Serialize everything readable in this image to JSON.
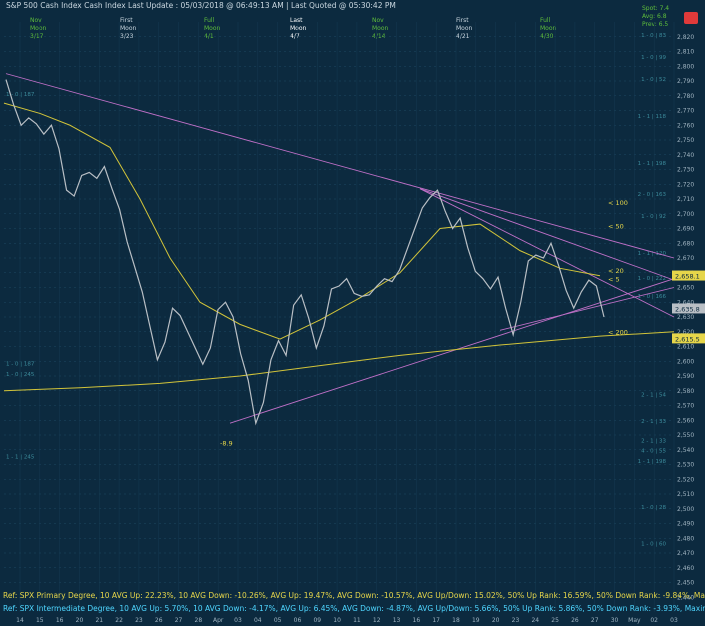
{
  "header": {
    "title": "S&P 500 Cash Index   Cash Index   Last Update : 05/03/2018 @ 06:49:13 AM | Last Quoted @ 05:30:42 PM",
    "phases": [
      {
        "top": "Nov",
        "mid": "Moon",
        "date": "3/17",
        "color": "#5fbf3b"
      },
      {
        "top": "First",
        "mid": "Moon",
        "date": "3/23",
        "color": "#c9d6df"
      },
      {
        "top": "Full",
        "mid": "Moon",
        "date": "4/1",
        "color": "#5fbf3b"
      },
      {
        "top": "Last",
        "mid": "Moon",
        "date": "4/7",
        "color": "#ffffff"
      },
      {
        "top": "Nov",
        "mid": "Moon",
        "date": "4/14",
        "color": "#5fbf3b"
      },
      {
        "top": "First",
        "mid": "Moon",
        "date": "4/21",
        "color": "#c9d6df"
      },
      {
        "top": "Full",
        "mid": "Moon",
        "date": "4/30",
        "color": "#5fbf3b"
      }
    ],
    "right_info": [
      "Spot: 7.4",
      "Avg: 6.8",
      "Prev: 6.5"
    ]
  },
  "chart_data": {
    "type": "line",
    "title": "S&P 500 Cash Index",
    "ylim": [
      2430,
      2830
    ],
    "y_ticks": [
      2440,
      2450,
      2460,
      2470,
      2480,
      2490,
      2500,
      2510,
      2520,
      2530,
      2540,
      2550,
      2560,
      2570,
      2580,
      2590,
      2600,
      2610,
      2620,
      2630,
      2640,
      2650,
      2660,
      2670,
      2680,
      2690,
      2700,
      2710,
      2720,
      2730,
      2740,
      2750,
      2760,
      2770,
      2780,
      2790,
      2800,
      2810,
      2820
    ],
    "x_labels": [
      "14",
      "15",
      "16",
      "20",
      "21",
      "22",
      "23",
      "26",
      "27",
      "28",
      "Apr",
      "03",
      "04",
      "05",
      "06",
      "09",
      "10",
      "11",
      "12",
      "13",
      "16",
      "17",
      "18",
      "19",
      "20",
      "23",
      "24",
      "25",
      "26",
      "27",
      "30",
      "May",
      "02",
      "03"
    ],
    "series": [
      {
        "name": "SPX",
        "color": "#b9bfc5",
        "values": [
          2791,
          2774,
          2760,
          2765,
          2761,
          2754,
          2760,
          2744,
          2716,
          2712,
          2726,
          2728,
          2724,
          2732,
          2717,
          2703,
          2681,
          2664,
          2647,
          2624,
          2601,
          2613,
          2636,
          2631,
          2620,
          2609,
          2598,
          2609,
          2635,
          2640,
          2630,
          2605,
          2587,
          2558,
          2572,
          2601,
          2614,
          2604,
          2638,
          2645,
          2629,
          2609,
          2624,
          2649,
          2651,
          2656,
          2646,
          2644,
          2645,
          2651,
          2656,
          2654,
          2662,
          2676,
          2690,
          2704,
          2711,
          2716,
          2702,
          2690,
          2697,
          2677,
          2661,
          2656,
          2649,
          2657,
          2636,
          2618,
          2640,
          2668,
          2672,
          2670,
          2680,
          2665,
          2648,
          2636,
          2647,
          2655,
          2651,
          2630
        ]
      },
      {
        "name": "Avg",
        "color": "#d2c43a"
      },
      {
        "name": "Trendline",
        "color": "#c070c8"
      }
    ],
    "levels": [
      {
        "value": 2658.1,
        "label": "2,658.1",
        "color": "#e6d64a"
      },
      {
        "value": 2635.8,
        "label": "2,635.8",
        "color": "#b9bfc5"
      },
      {
        "value": 2615.5,
        "label": "2,615.5",
        "color": "#e6d64a"
      }
    ],
    "annotations": [
      {
        "text": "< 100",
        "color": "#e6d64a"
      },
      {
        "text": "< 50",
        "color": "#e6d64a"
      },
      {
        "text": "< 20",
        "color": "#e6d64a"
      },
      {
        "text": "< 5",
        "color": "#e6d64a"
      },
      {
        "text": "< 200",
        "color": "#e6d64a"
      },
      {
        "text": "-8.9",
        "color": "#e6d64a"
      }
    ],
    "fib_labels": [
      "1 - 0 | 83",
      "1 - 0 | 99",
      "1 - 0 | 52",
      "1 - 1 | 118",
      "1 - 1 | 198",
      "2 - 0 | 163",
      "1 - 0 | 92",
      "1 - 1 | 120",
      "1 - 0 | 166",
      "1 - 0 | 222",
      "2 - 1 | 54",
      "2 - 1 | 33",
      "2 - 1 | 33",
      "4 - 0 | 55",
      "1 - 1 | 198",
      "1 - 0 | 28",
      "1 - 0 | 60",
      "1 - 0 | 187",
      "1 - 1 | 245",
      "1 - 0 | 245",
      "1 - 0 | 187"
    ]
  },
  "footer": {
    "line1": "Ref: SPX Primary Degree, 10 AVG Up: 22.23%, 10 AVG Down: -10.26%, AVG Up: 19.47%, AVG Down: -10.57%, AVG Up/Down: 15.02%, 50% Up Rank: 16.59%, 50% Down Rank: -9.84%, Maximum Up: 58.71%, Maximum",
    "line2": "Ref: SPX Intermediate Degree, 10 AVG Up: 5.70%, 10 AVG Down: -4.17%, AVG Up: 6.45%, AVG Down: -4.87%, AVG Up/Down: 5.66%, 50% Up Rank: 5.86%, 50% Down Rank: -3.93%, Maximum Up: 20.27%, Maximum Dc"
  }
}
